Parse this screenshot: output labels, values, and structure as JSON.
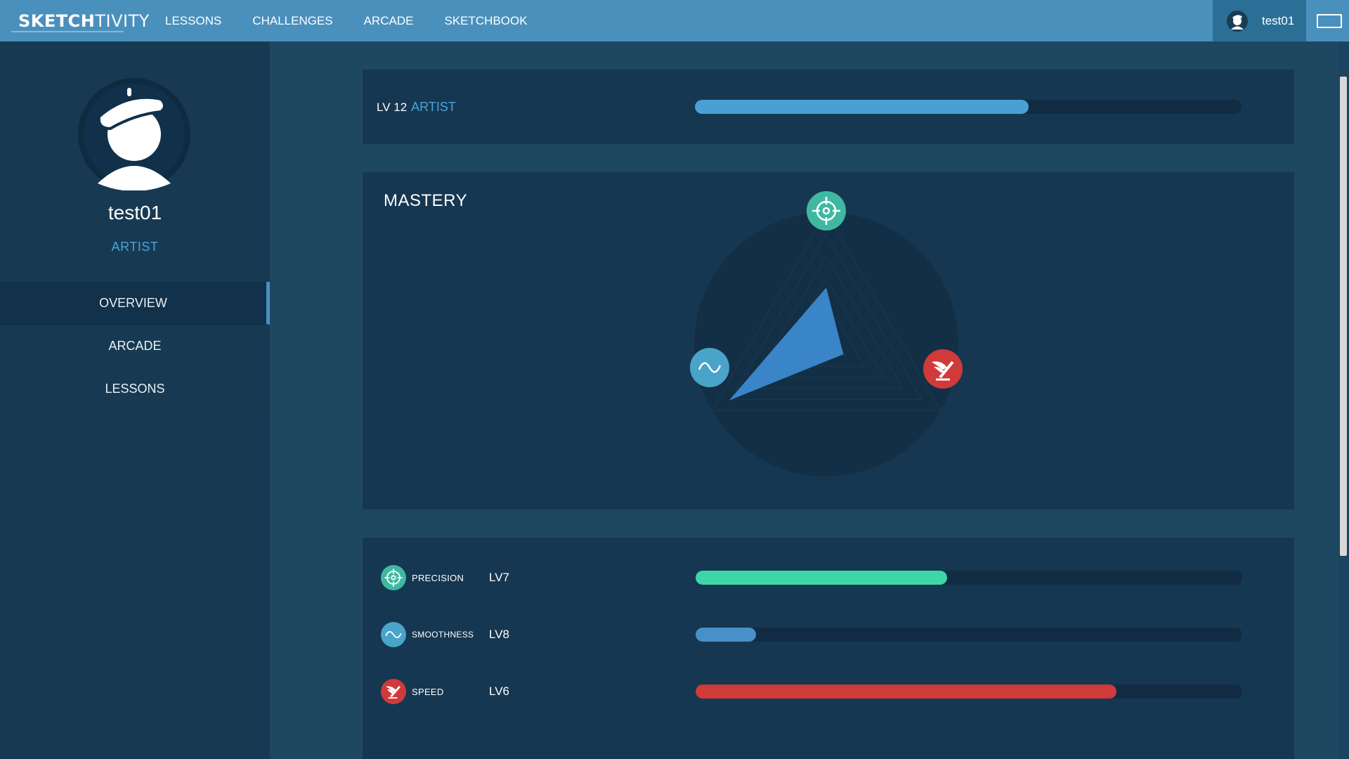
{
  "app": {
    "logo_bold": "SKETCH",
    "logo_thin": "TIVITY"
  },
  "nav": {
    "items": [
      {
        "label": "LESSONS"
      },
      {
        "label": "CHALLENGES"
      },
      {
        "label": "ARCADE"
      },
      {
        "label": "SKETCHBOOK"
      }
    ]
  },
  "user": {
    "name": "test01"
  },
  "profile": {
    "name": "test01",
    "rank": "ARTIST"
  },
  "sidebar": {
    "items": [
      {
        "label": "OVERVIEW",
        "active": true
      },
      {
        "label": "ARCADE",
        "active": false
      },
      {
        "label": "LESSONS",
        "active": false
      }
    ]
  },
  "level": {
    "level_text": "LV 12",
    "rank": "ARTIST",
    "progress": 0.61,
    "color": "#4a9fd5"
  },
  "mastery": {
    "title": "MASTERY",
    "axes": [
      {
        "name": "precision",
        "icon": "crosshair-icon",
        "color": "#3fb8a2",
        "value": 0.43
      },
      {
        "name": "speed",
        "icon": "winged-pen-icon",
        "color": "#d03a3a",
        "value": 0.15
      },
      {
        "name": "smoothness",
        "icon": "sine-wave-icon",
        "color": "#4aa3c8",
        "value": 0.85
      }
    ],
    "shape_color": "#3a84c8"
  },
  "stats": [
    {
      "name": "PRECISION",
      "level": "LV7",
      "progress": 0.46,
      "color": "#3ed6a9",
      "icon": "crosshair-icon"
    },
    {
      "name": "SMOOTHNESS",
      "level": "LV8",
      "progress": 0.11,
      "color": "#4a90c8",
      "icon": "sine-wave-icon"
    },
    {
      "name": "SPEED",
      "level": "LV6",
      "progress": 0.77,
      "color": "#cf3a3a",
      "icon": "winged-pen-icon"
    }
  ]
}
